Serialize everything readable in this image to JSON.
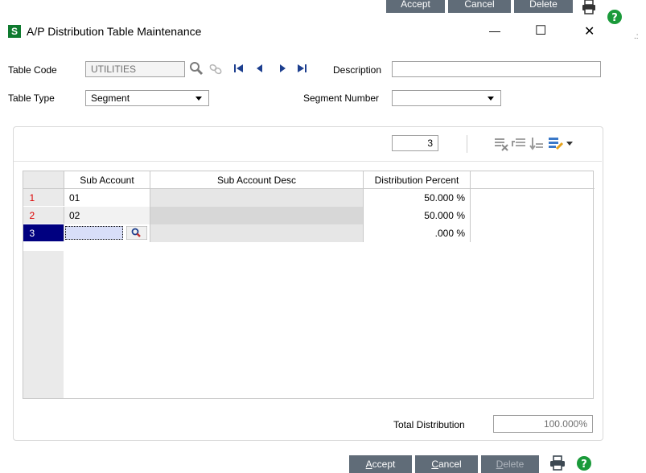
{
  "top_buttons": {
    "accept": "Accept",
    "cancel": "Cancel",
    "delete": "Delete"
  },
  "window": {
    "app_icon": "S",
    "title": "A/P Distribution Table Maintenance",
    "minimize": "—",
    "maximize": "☐",
    "close": "✕"
  },
  "form": {
    "table_code_label": "Table Code",
    "table_code_value": "UTILITIES",
    "description_label": "Description",
    "description_value": "",
    "table_type_label": "Table Type",
    "table_type_value": "Segment",
    "segment_number_label": "Segment Number",
    "segment_number_value": ""
  },
  "grid_toolbar": {
    "row_count": "3"
  },
  "grid": {
    "columns": [
      "Sub Account",
      "Sub Account Desc",
      "Distribution Percent"
    ],
    "rows": [
      {
        "num": "1",
        "sub_account": "01",
        "desc": "",
        "percent": "50.000 %"
      },
      {
        "num": "2",
        "sub_account": "02",
        "desc": "",
        "percent": "50.000 %"
      },
      {
        "num": "3",
        "sub_account": "",
        "desc": "",
        "percent": ".000 %"
      }
    ]
  },
  "totals": {
    "label": "Total Distribution",
    "value": "100.000%"
  },
  "bottom_buttons": {
    "accept_u": "A",
    "accept_rest": "ccept",
    "cancel_u": "C",
    "cancel_rest": "ancel",
    "delete_u": "D",
    "delete_rest": "elete"
  },
  "colors": {
    "button_bg": "#606c78",
    "selected_row": "#000080",
    "row_number_text": "#dd0000",
    "help_green": "#1a9a3a"
  }
}
